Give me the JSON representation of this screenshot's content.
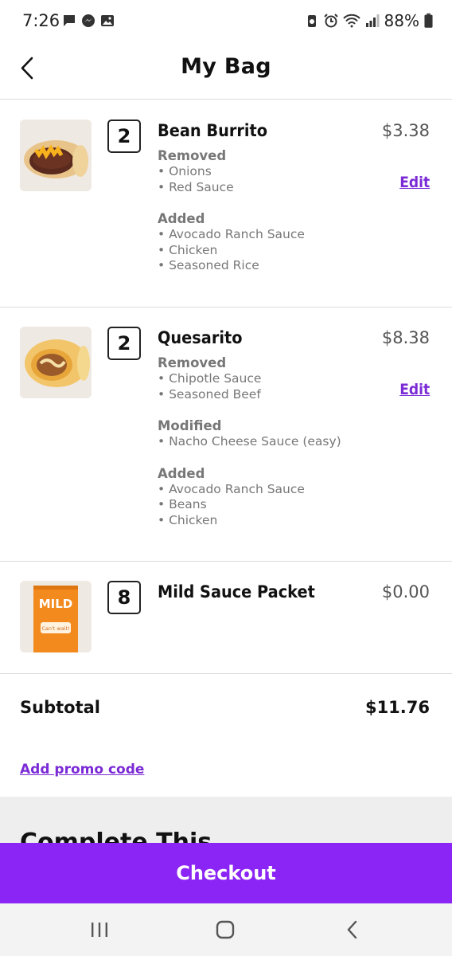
{
  "status_bar": {
    "time": "7:26",
    "battery_pct": "88%",
    "left_icons": [
      "chat-icon",
      "messenger-icon",
      "gallery-icon"
    ],
    "right_icons": [
      "alarm-icon",
      "wifi-icon",
      "signal-icon",
      "battery-icon"
    ]
  },
  "header": {
    "title": "My Bag",
    "back_icon": "chevron-left-icon"
  },
  "items": [
    {
      "qty": "2",
      "name": "Bean Burrito",
      "price": "$3.38",
      "edit_label": "Edit",
      "groups": [
        {
          "label": "Removed",
          "lines": [
            "Onions",
            "Red Sauce"
          ]
        },
        {
          "label": "Added",
          "lines": [
            "Avocado Ranch Sauce",
            "Chicken",
            "Seasoned Rice"
          ]
        }
      ]
    },
    {
      "qty": "2",
      "name": "Quesarito",
      "price": "$8.38",
      "edit_label": "Edit",
      "groups": [
        {
          "label": "Removed",
          "lines": [
            "Chipotle Sauce",
            "Seasoned Beef"
          ]
        },
        {
          "label": "Modified",
          "lines": [
            "Nacho Cheese Sauce (easy)"
          ]
        },
        {
          "label": "Added",
          "lines": [
            "Avocado Ranch Sauce",
            "Beans",
            "Chicken"
          ]
        }
      ]
    },
    {
      "qty": "8",
      "name": "Mild Sauce Packet",
      "price": "$0.00",
      "packet_text": "MILD",
      "packet_subtext": "Can't wait!"
    }
  ],
  "subtotal": {
    "label": "Subtotal",
    "value": "$11.76"
  },
  "promo": {
    "label": "Add promo code"
  },
  "peek_heading": "Complete This",
  "checkout": {
    "label": "Checkout"
  },
  "colors": {
    "accent": "#8b25f5",
    "link": "#7b2bd6",
    "muted_text": "#777777"
  }
}
